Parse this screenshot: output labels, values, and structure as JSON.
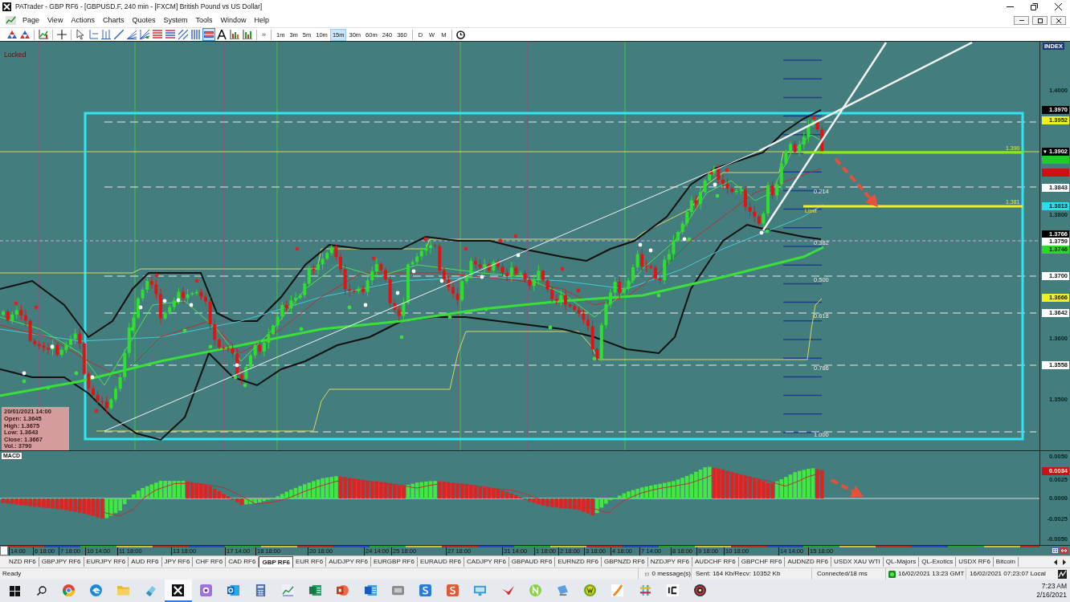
{
  "window": {
    "title": "PATrader - GBP RF6 - [GBPUSD.F, 240 min - [FXCM] British Pound vs US Dollar]"
  },
  "menu": [
    "Page",
    "View",
    "Actions",
    "Charts",
    "Quotes",
    "System",
    "Tools",
    "Window",
    "Help"
  ],
  "toolbar": {
    "tools": [
      {
        "pressed": false
      },
      {
        "pressed": false
      },
      {
        "pressed": false
      },
      {
        "pressed": false
      },
      {
        "pressed": false
      },
      {
        "pressed": false
      },
      {
        "pressed": false
      },
      {
        "pressed": false
      },
      {
        "pressed": false
      },
      {
        "pressed": false
      },
      {
        "pressed": false
      },
      {
        "pressed": false
      },
      {
        "pressed": false
      },
      {
        "pressed": false
      },
      {
        "pressed": true
      },
      {
        "pressed": false
      },
      {
        "pressed": false
      },
      {
        "pressed": false
      }
    ],
    "more": "»",
    "timeframes": [
      {
        "label": "1m",
        "highlighted": false
      },
      {
        "label": "3m",
        "highlighted": false
      },
      {
        "label": "5m",
        "highlighted": false
      },
      {
        "label": "10m",
        "highlighted": false
      },
      {
        "label": "15m",
        "highlighted": true
      },
      {
        "label": "30m",
        "highlighted": false
      },
      {
        "label": "60m",
        "highlighted": false
      },
      {
        "label": "240",
        "highlighted": false
      },
      {
        "label": "360",
        "highlighted": false
      }
    ],
    "periods": [
      "D",
      "W",
      "M"
    ]
  },
  "chart": {
    "status": "Locked",
    "ohlc": {
      "date": "20/01/2021 14:00",
      "rows": [
        "Open: 1.3645",
        "High: 1.3675",
        "Low: 1.3643",
        "Close: 1.3667",
        "Vol.: 3790"
      ]
    },
    "fib_levels": [
      "0.214",
      "0.382",
      "0.500",
      "0.618",
      "0.786",
      "1.000"
    ],
    "line_labels": [
      "1.390",
      "1.381"
    ],
    "order_label": "Limit",
    "price_axis": {
      "title": "INDEX",
      "labels": [
        {
          "text": "1.4000"
        },
        {
          "text": "1.3970",
          "color": "#000000"
        },
        {
          "text": "1.3952",
          "color": "#f0f020"
        },
        {
          "text": "1.3902",
          "color": "#000000",
          "marker": "▼"
        },
        {
          "color": "#22cc22"
        },
        {
          "color": "#cc1111"
        },
        {
          "text": "1.3843",
          "color": "#ffffff"
        },
        {
          "text": "1.3813",
          "color": "#22e0f0"
        },
        {
          "text": "1.3800"
        },
        {
          "text": "1.3766",
          "color": "#000000"
        },
        {
          "text": "1.3759",
          "color": "#ffffff"
        },
        {
          "text": "1.3746",
          "color": "#22dd22"
        },
        {
          "text": "1.3700",
          "color": "#ffffff"
        },
        {
          "text": "1.3666",
          "color": "#f0f020"
        },
        {
          "text": "1.3642",
          "color": "#ffffff"
        },
        {
          "text": "1.3600"
        },
        {
          "text": "1.3558",
          "color": "#ffffff"
        },
        {
          "text": "1.3500"
        }
      ]
    }
  },
  "macd": {
    "title": "MACD",
    "axis_labels": [
      {
        "text": "0.0050"
      },
      {
        "text": "0.0034",
        "color": "#cc1111"
      },
      {
        "text": "0.0025"
      },
      {
        "text": "0.0000"
      },
      {
        "text": "-0.0025"
      },
      {
        "text": "-0.0050"
      }
    ]
  },
  "time_axis": [
    "14:00",
    "6 18:00",
    "7 18:00",
    "10 14:00",
    "11 18:00",
    "13 18:00",
    "17 14:00",
    "18 18:00",
    "20 18:00",
    "24 14:00",
    "25 18:00",
    "27 18:00",
    "31 14:00",
    "1 18:00",
    "2 18:00",
    "3 18:00",
    "4 18:00",
    "7 14:00",
    "8 18:00",
    "9 18:00",
    "10 18:00",
    "14 14:00",
    "15 18:00"
  ],
  "tabs": [
    {
      "label": "NZD RF6",
      "selected": false
    },
    {
      "label": "GBPJPY RF6",
      "selected": false
    },
    {
      "label": "EURJPY RF6",
      "selected": false
    },
    {
      "label": "AUD RF6",
      "selected": false
    },
    {
      "label": "JPY RF6",
      "selected": false
    },
    {
      "label": "CHF RF6",
      "selected": false
    },
    {
      "label": "CAD RF6",
      "selected": false
    },
    {
      "label": "GBP RF6",
      "selected": true
    },
    {
      "label": "EUR RF6",
      "selected": false
    },
    {
      "label": "AUDJPY RF6",
      "selected": false
    },
    {
      "label": "EURGBP RF6",
      "selected": false
    },
    {
      "label": "EURAUD RF6",
      "selected": false
    },
    {
      "label": "CADJPY RF6",
      "selected": false
    },
    {
      "label": "GBPAUD RF6",
      "selected": false
    },
    {
      "label": "EURNZD RF6",
      "selected": false
    },
    {
      "label": "GBPNZD RF6",
      "selected": false
    },
    {
      "label": "NZDJPY RF6",
      "selected": false
    },
    {
      "label": "AUDCHF RF6",
      "selected": false
    },
    {
      "label": "GBPCHF RF6",
      "selected": false
    },
    {
      "label": "AUDNZD RF6",
      "selected": false
    },
    {
      "label": "USDX XAU WTI",
      "selected": false
    },
    {
      "label": "QL-Majors",
      "selected": false
    },
    {
      "label": "QL-Exotics",
      "selected": false
    },
    {
      "label": "USDX RF6",
      "selected": false
    },
    {
      "label": "Bitcoin",
      "selected": false
    }
  ],
  "status_bar": {
    "state": "Ready",
    "messages": "0 message(s)",
    "traffic": "Sent: 164 Kb/Recv: 10352 Kb",
    "connection": "Connected/18 ms",
    "gmt_time": "16/02/2021 13:23 GMT",
    "local_time": "16/02/2021 07:23:07 Local"
  },
  "taskbar": {
    "apps": [
      {
        "active": false
      },
      {
        "active": false
      },
      {
        "active": false
      },
      {
        "active": false
      },
      {
        "active": true
      },
      {
        "active": false
      },
      {
        "active": false
      },
      {
        "active": false
      },
      {
        "active": false
      },
      {
        "active": false
      },
      {
        "active": false
      },
      {
        "active": false
      },
      {
        "active": false
      },
      {
        "active": false
      },
      {
        "active": false
      },
      {
        "active": false
      },
      {
        "active": false
      },
      {
        "active": false
      },
      {
        "active": false
      },
      {
        "active": false
      },
      {
        "active": false
      },
      {
        "active": false
      },
      {
        "active": false
      },
      {
        "active": false
      }
    ],
    "time": "7:23 AM",
    "date": "2/16/2021"
  }
}
